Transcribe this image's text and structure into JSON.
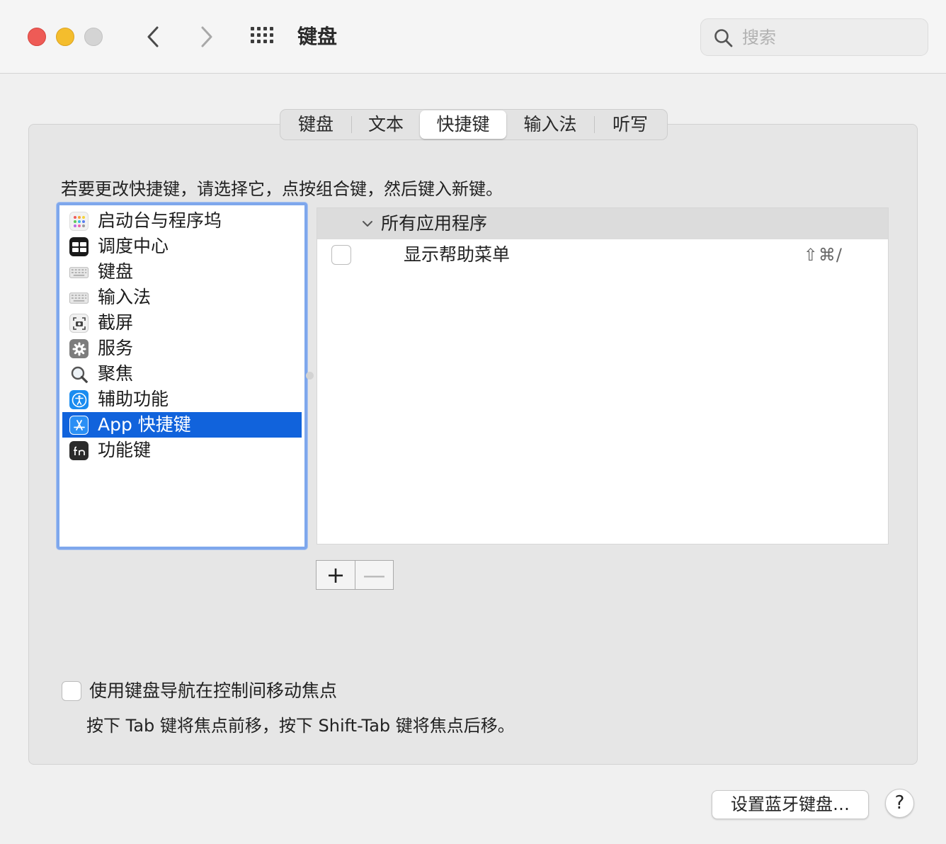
{
  "window": {
    "title": "键盘",
    "search_placeholder": "搜索"
  },
  "tabs": [
    {
      "label": "键盘",
      "active": false
    },
    {
      "label": "文本",
      "active": false
    },
    {
      "label": "快捷键",
      "active": true
    },
    {
      "label": "输入法",
      "active": false
    },
    {
      "label": "听写",
      "active": false
    }
  ],
  "instruction": "若要更改快捷键，请选择它，点按组合键，然后键入新键。",
  "categories": [
    {
      "label": "启动台与程序坞",
      "icon": "launchpad-icon",
      "selected": false
    },
    {
      "label": "调度中心",
      "icon": "mission-control-icon",
      "selected": false
    },
    {
      "label": "键盘",
      "icon": "keyboard-icon",
      "selected": false
    },
    {
      "label": "输入法",
      "icon": "input-source-icon",
      "selected": false
    },
    {
      "label": "截屏",
      "icon": "screenshot-icon",
      "selected": false
    },
    {
      "label": "服务",
      "icon": "gear-icon",
      "selected": false
    },
    {
      "label": "聚焦",
      "icon": "spotlight-icon",
      "selected": false
    },
    {
      "label": "辅助功能",
      "icon": "accessibility-icon",
      "selected": false
    },
    {
      "label": "App 快捷键",
      "icon": "app-store-icon",
      "selected": true
    },
    {
      "label": "功能键",
      "icon": "fn-key-icon",
      "selected": false
    }
  ],
  "shortcuts": {
    "group_label": "所有应用程序",
    "rows": [
      {
        "label": "显示帮助菜单",
        "keys": "⇧⌘/",
        "checked": false
      }
    ]
  },
  "controls": {
    "add_label": "+",
    "remove_label": "—"
  },
  "keyboard_nav": {
    "label": "使用键盘导航在控制间移动焦点",
    "hint": "按下 Tab 键将焦点前移，按下 Shift-Tab 键将焦点后移。",
    "checked": false
  },
  "footer": {
    "bluetooth_button": "设置蓝牙键盘…",
    "help_button": "?"
  },
  "colors": {
    "selection": "#1163dc",
    "focus_ring": "#7ea7ec",
    "close": "#ee5b56",
    "minimize": "#f4bd2d"
  }
}
